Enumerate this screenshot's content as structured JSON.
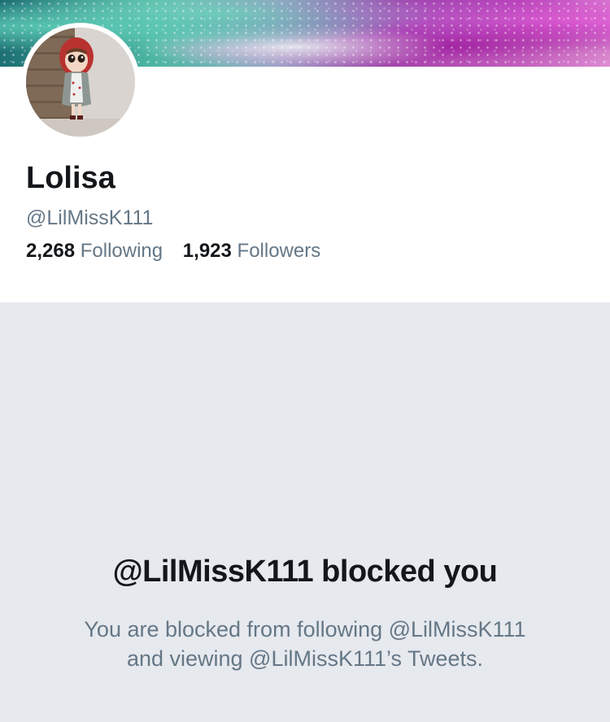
{
  "profile": {
    "name": "Lolisa",
    "handle": "@LilMissK111",
    "following_count": "2,268",
    "following_label": "Following",
    "followers_count": "1,923",
    "followers_label": "Followers"
  },
  "blocked_notice": {
    "title": "@LilMissK111 blocked you",
    "line1": "You are blocked from following @LilMissK111",
    "line2": "and viewing @LilMissK111’s Tweets."
  },
  "colors": {
    "background": "#e6e9ee",
    "card": "#ffffff",
    "primary_text": "#14171a",
    "secondary_text": "#657786"
  }
}
